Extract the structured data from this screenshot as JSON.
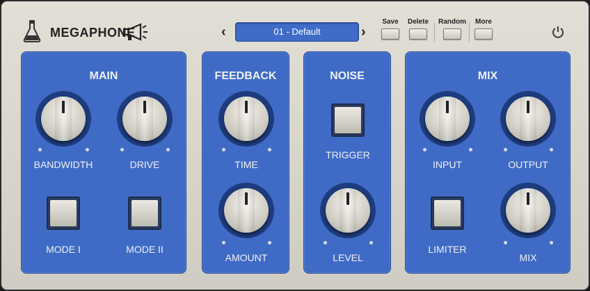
{
  "header": {
    "logo_icon": "flask-icon",
    "title": "MEGAPHONE",
    "brand_icon": "megaphone-icon",
    "preset": {
      "prev_icon": "chevron-left-icon",
      "prev_glyph": "‹",
      "name": "01 - Default",
      "next_icon": "chevron-right-icon",
      "next_glyph": "›"
    },
    "buttons": {
      "save": "Save",
      "delete": "Delete",
      "random": "Random",
      "more": "More"
    },
    "power_icon": "power-icon"
  },
  "panels": {
    "main": {
      "title": "MAIN",
      "bandwidth": "BANDWIDTH",
      "drive": "DRIVE",
      "mode1": "MODE I",
      "mode2": "MODE II"
    },
    "feedback": {
      "title": "FEEDBACK",
      "time": "TIME",
      "amount": "AMOUNT"
    },
    "noise": {
      "title": "NOISE",
      "trigger": "TRIGGER",
      "level": "LEVEL"
    },
    "mix": {
      "title": "MIX",
      "input": "INPUT",
      "output": "OUTPUT",
      "limiter": "LIMITER",
      "mix": "MIX"
    }
  },
  "colors": {
    "panel": "#3f6bc6",
    "ring": "#1e3c7d",
    "preset_bg": "#3f6cc9",
    "background": "#d8d5cc"
  }
}
